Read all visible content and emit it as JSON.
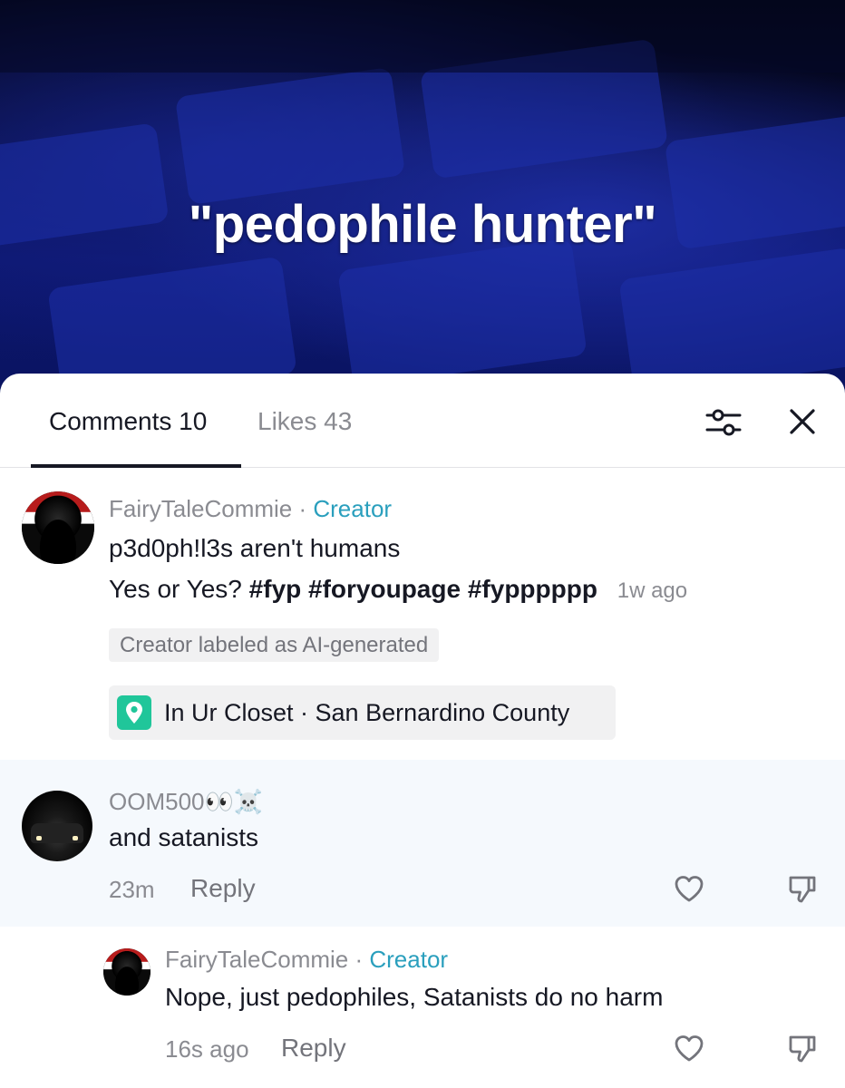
{
  "video": {
    "overlay_text": "\"pedophile hunter\""
  },
  "tabs": {
    "comments": "Comments 10",
    "likes": "Likes 43"
  },
  "comments": [
    {
      "username": "FairyTaleCommie",
      "separator": " · ",
      "badge": "Creator",
      "title": "p3d0ph!l3s aren't humans",
      "text": "Yes or Yes?",
      "hashtags": [
        "#fyp",
        "#foryoupage",
        "#fypppppp"
      ],
      "time": "1w ago",
      "ai_label": "Creator labeled as AI-generated",
      "location": "In Ur Closet · San Bernardino County"
    },
    {
      "username": "OOM500👀☠️",
      "text": "and satanists",
      "time": "23m",
      "reply_label": "Reply"
    },
    {
      "username": "FairyTaleCommie",
      "separator": " · ",
      "badge": "Creator",
      "text": "Nope, just pedophiles, Satanists do no harm",
      "time": "16s ago",
      "reply_label": "Reply"
    }
  ],
  "icons": {
    "filter": "sliders-icon",
    "close": "close-icon",
    "location": "location-pin-icon",
    "like": "heart-icon",
    "dislike": "thumbs-down-icon"
  },
  "colors": {
    "creator_badge": "#2a9fbd",
    "location_icon_bg": "#20c69a",
    "highlight_bg": "#f5f9fd"
  }
}
